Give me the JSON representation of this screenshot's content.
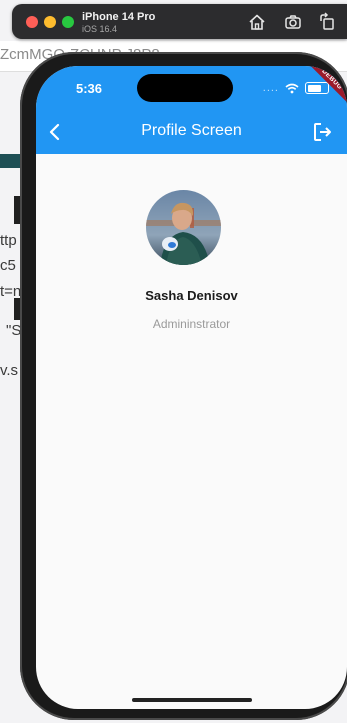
{
  "background": {
    "editor_fragment_top": "ZcmMGO-ZCUNP J8P8",
    "editor_fragments": [
      "ttp",
      "c5",
      "t=n",
      "\"S",
      "v.s"
    ]
  },
  "simulator": {
    "device_name": "iPhone 14 Pro",
    "os_version": "iOS 16.4",
    "toolbar_icons": [
      "home-icon",
      "screenshot-icon",
      "rotate-icon"
    ]
  },
  "status_bar": {
    "time": "5:36",
    "signal": "....",
    "battery_level": 0.85
  },
  "debug_banner": "DEBUG",
  "app_bar": {
    "title": "Profile Screen",
    "back_icon": "chevron-left-icon",
    "action_icon": "logout-icon",
    "color": "#2196f3"
  },
  "profile": {
    "name": "Sasha Denisov",
    "role": "Admininstrator"
  }
}
